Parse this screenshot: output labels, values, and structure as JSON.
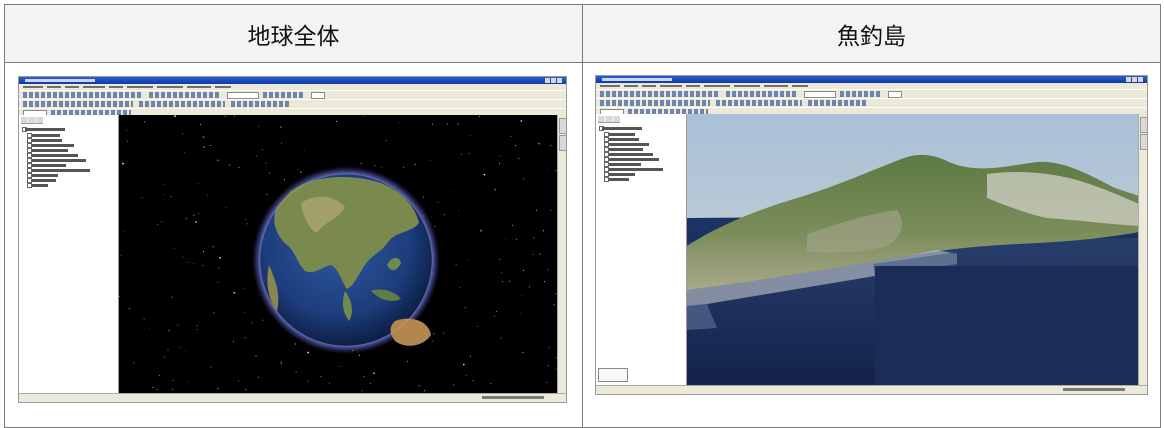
{
  "table": {
    "columns": [
      {
        "header": "地球全体"
      },
      {
        "header": "魚釣島"
      }
    ]
  },
  "screens": {
    "globe": {
      "view": "globe-in-space"
    },
    "island": {
      "view": "3d-terrain-island"
    }
  },
  "colors": {
    "space": "#000000",
    "ocean": "#1c2f58",
    "sky": "#b4c6d7",
    "title_bar": "#1f4fc0",
    "chrome": "#ece9d8"
  }
}
